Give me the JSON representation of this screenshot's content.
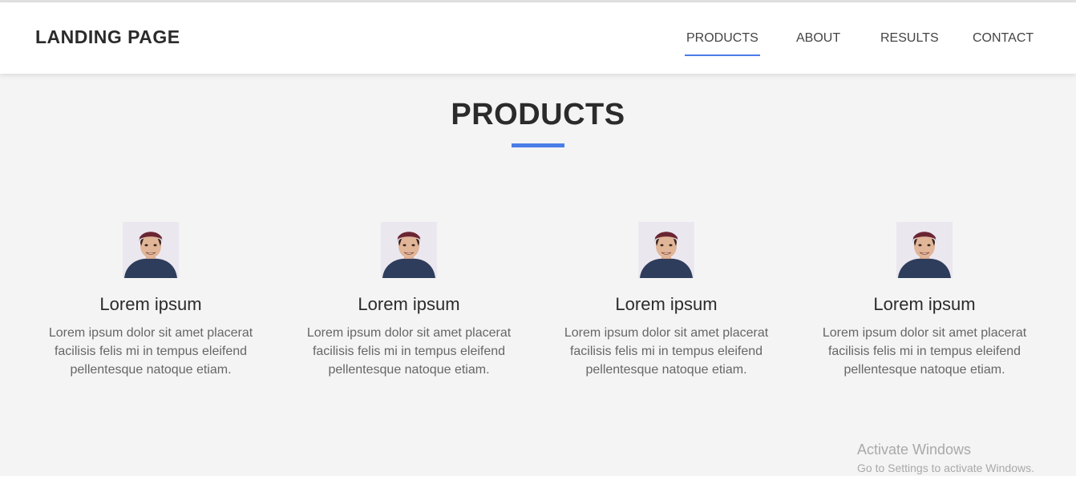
{
  "header": {
    "brand": "LANDING PAGE",
    "nav": [
      {
        "label": "PRODUCTS",
        "active": true
      },
      {
        "label": "ABOUT",
        "active": false
      },
      {
        "label": "RESULTS",
        "active": false
      },
      {
        "label": "CONTACT",
        "active": false
      }
    ]
  },
  "products": {
    "title": "PRODUCTS",
    "items": [
      {
        "title": "Lorem ipsum",
        "text": "Lorem ipsum dolor sit amet placerat facilisis felis mi in tempus eleifend pellentesque natoque etiam."
      },
      {
        "title": "Lorem ipsum",
        "text": "Lorem ipsum dolor sit amet placerat facilisis felis mi in tempus eleifend pellentesque natoque etiam."
      },
      {
        "title": "Lorem ipsum",
        "text": "Lorem ipsum dolor sit amet placerat facilisis felis mi in tempus eleifend pellentesque natoque etiam."
      },
      {
        "title": "Lorem ipsum",
        "text": "Lorem ipsum dolor sit amet placerat facilisis felis mi in tempus eleifend pellentesque natoque etiam."
      }
    ]
  },
  "watermark": {
    "title": "Activate Windows",
    "subtitle": "Go to Settings to activate Windows."
  },
  "colors": {
    "accent": "#4a7de8",
    "section_bg": "#f4f4f4",
    "text_dark": "#2b2b2b",
    "text_muted": "#666666"
  }
}
